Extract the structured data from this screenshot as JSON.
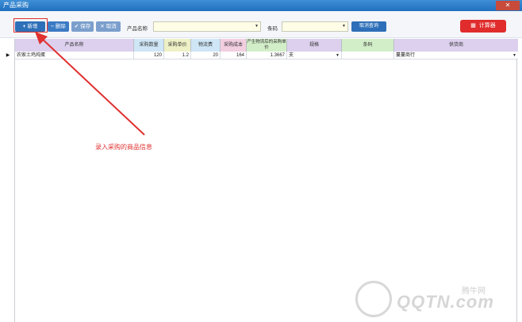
{
  "window": {
    "title": "产品采购",
    "close_label": "✕"
  },
  "toolbar": {
    "add_label": "新增",
    "delete_label": "删除",
    "save_label": "保存",
    "cancel_label": "取消",
    "product_name_label": "产品名称",
    "product_name_value": "",
    "barcode_label": "条码",
    "barcode_value": "",
    "query_cancel_label": "取消查询",
    "calculator_label": "计算器"
  },
  "grid": {
    "columns": [
      {
        "label": "产品名称",
        "color": "#dcd0ee"
      },
      {
        "label": "采购数量",
        "color": "#cfe6f6"
      },
      {
        "label": "采购单价",
        "color": "#eef0c6"
      },
      {
        "label": "物流费",
        "color": "#cfe6f6"
      },
      {
        "label": "采购成本",
        "color": "#f2cfe0"
      },
      {
        "label": "产生物流后的采购单价",
        "color": "#d2eec8"
      },
      {
        "label": "规格",
        "color": "#dcd0ee"
      },
      {
        "label": "条码",
        "color": "#d2eec8"
      },
      {
        "label": "供货商",
        "color": "#dcd0ee"
      }
    ],
    "rows": [
      {
        "product_name": "农家土鸡炖蛋",
        "quantity": "120",
        "unit_price": "1.2",
        "logistics_fee": "20",
        "cost": "164",
        "unit_price_after_logistics": "1.3667",
        "spec": "支",
        "barcode": "",
        "supplier": "蔓蔓商行"
      }
    ],
    "current_row_marker": "▶"
  },
  "annotation": {
    "text": "录入采购的商品信息",
    "color": "#e03030"
  },
  "watermark": {
    "text": "QQTN.com",
    "small_text": "腾牛网"
  }
}
